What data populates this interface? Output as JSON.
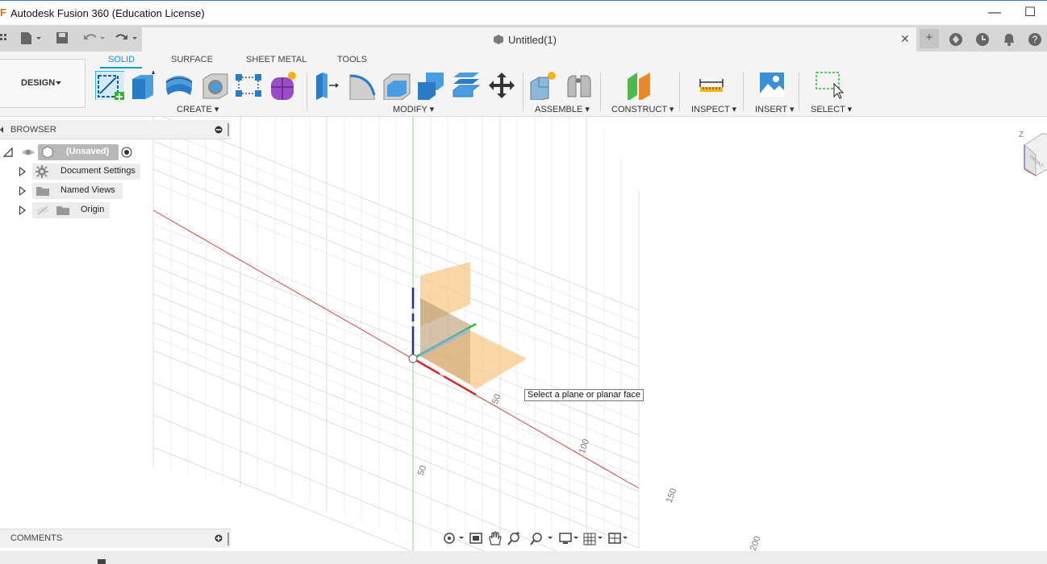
{
  "window": {
    "title": "Autodesk Fusion 360 (Education License)",
    "minimize_glyph": "—",
    "maximize_glyph": "☐"
  },
  "document": {
    "tab_label": "Untitled(1)",
    "close_glyph": "✕"
  },
  "workspace": {
    "label": "DESIGN",
    "tabs": [
      {
        "label": "SOLID",
        "active": true
      },
      {
        "label": "SURFACE",
        "active": false
      },
      {
        "label": "SHEET METAL",
        "active": false
      },
      {
        "label": "TOOLS",
        "active": false
      }
    ],
    "groups": [
      {
        "label": "CREATE"
      },
      {
        "label": "MODIFY"
      },
      {
        "label": "ASSEMBLE"
      },
      {
        "label": "CONSTRUCT"
      },
      {
        "label": "INSPECT"
      },
      {
        "label": "INSERT"
      },
      {
        "label": "SELECT"
      }
    ]
  },
  "browser": {
    "title": "BROWSER",
    "root": "(Unsaved)",
    "items": [
      {
        "label": "Document Settings",
        "icon": "gear-icon"
      },
      {
        "label": "Named Views",
        "icon": "folder-icon"
      },
      {
        "label": "Origin",
        "icon": "folder-icon"
      }
    ]
  },
  "comments": {
    "title": "COMMENTS"
  },
  "canvas": {
    "tooltip": "Select a plane or planar face",
    "axis_labels": [
      "50",
      "100",
      "150",
      "200",
      "50"
    ]
  },
  "viewcube": {
    "z_label": "Z",
    "face_label": "FRONT"
  },
  "colors": {
    "accent": "#0696d7",
    "x_axis": "#d62a2a",
    "y_axis": "#2fb82f",
    "z_axis": "#1b2fa3",
    "plane": "#f7c27a"
  }
}
